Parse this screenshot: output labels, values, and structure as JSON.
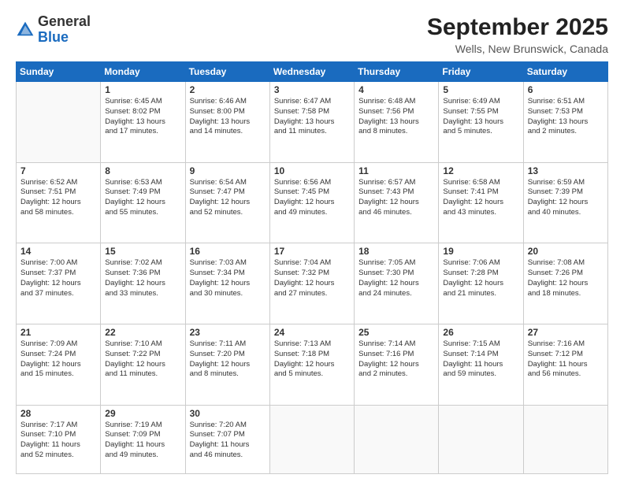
{
  "logo": {
    "general": "General",
    "blue": "Blue"
  },
  "header": {
    "month": "September 2025",
    "location": "Wells, New Brunswick, Canada"
  },
  "days": [
    "Sunday",
    "Monday",
    "Tuesday",
    "Wednesday",
    "Thursday",
    "Friday",
    "Saturday"
  ],
  "weeks": [
    [
      {
        "day": "",
        "info": ""
      },
      {
        "day": "1",
        "info": "Sunrise: 6:45 AM\nSunset: 8:02 PM\nDaylight: 13 hours\nand 17 minutes."
      },
      {
        "day": "2",
        "info": "Sunrise: 6:46 AM\nSunset: 8:00 PM\nDaylight: 13 hours\nand 14 minutes."
      },
      {
        "day": "3",
        "info": "Sunrise: 6:47 AM\nSunset: 7:58 PM\nDaylight: 13 hours\nand 11 minutes."
      },
      {
        "day": "4",
        "info": "Sunrise: 6:48 AM\nSunset: 7:56 PM\nDaylight: 13 hours\nand 8 minutes."
      },
      {
        "day": "5",
        "info": "Sunrise: 6:49 AM\nSunset: 7:55 PM\nDaylight: 13 hours\nand 5 minutes."
      },
      {
        "day": "6",
        "info": "Sunrise: 6:51 AM\nSunset: 7:53 PM\nDaylight: 13 hours\nand 2 minutes."
      }
    ],
    [
      {
        "day": "7",
        "info": "Sunrise: 6:52 AM\nSunset: 7:51 PM\nDaylight: 12 hours\nand 58 minutes."
      },
      {
        "day": "8",
        "info": "Sunrise: 6:53 AM\nSunset: 7:49 PM\nDaylight: 12 hours\nand 55 minutes."
      },
      {
        "day": "9",
        "info": "Sunrise: 6:54 AM\nSunset: 7:47 PM\nDaylight: 12 hours\nand 52 minutes."
      },
      {
        "day": "10",
        "info": "Sunrise: 6:56 AM\nSunset: 7:45 PM\nDaylight: 12 hours\nand 49 minutes."
      },
      {
        "day": "11",
        "info": "Sunrise: 6:57 AM\nSunset: 7:43 PM\nDaylight: 12 hours\nand 46 minutes."
      },
      {
        "day": "12",
        "info": "Sunrise: 6:58 AM\nSunset: 7:41 PM\nDaylight: 12 hours\nand 43 minutes."
      },
      {
        "day": "13",
        "info": "Sunrise: 6:59 AM\nSunset: 7:39 PM\nDaylight: 12 hours\nand 40 minutes."
      }
    ],
    [
      {
        "day": "14",
        "info": "Sunrise: 7:00 AM\nSunset: 7:37 PM\nDaylight: 12 hours\nand 37 minutes."
      },
      {
        "day": "15",
        "info": "Sunrise: 7:02 AM\nSunset: 7:36 PM\nDaylight: 12 hours\nand 33 minutes."
      },
      {
        "day": "16",
        "info": "Sunrise: 7:03 AM\nSunset: 7:34 PM\nDaylight: 12 hours\nand 30 minutes."
      },
      {
        "day": "17",
        "info": "Sunrise: 7:04 AM\nSunset: 7:32 PM\nDaylight: 12 hours\nand 27 minutes."
      },
      {
        "day": "18",
        "info": "Sunrise: 7:05 AM\nSunset: 7:30 PM\nDaylight: 12 hours\nand 24 minutes."
      },
      {
        "day": "19",
        "info": "Sunrise: 7:06 AM\nSunset: 7:28 PM\nDaylight: 12 hours\nand 21 minutes."
      },
      {
        "day": "20",
        "info": "Sunrise: 7:08 AM\nSunset: 7:26 PM\nDaylight: 12 hours\nand 18 minutes."
      }
    ],
    [
      {
        "day": "21",
        "info": "Sunrise: 7:09 AM\nSunset: 7:24 PM\nDaylight: 12 hours\nand 15 minutes."
      },
      {
        "day": "22",
        "info": "Sunrise: 7:10 AM\nSunset: 7:22 PM\nDaylight: 12 hours\nand 11 minutes."
      },
      {
        "day": "23",
        "info": "Sunrise: 7:11 AM\nSunset: 7:20 PM\nDaylight: 12 hours\nand 8 minutes."
      },
      {
        "day": "24",
        "info": "Sunrise: 7:13 AM\nSunset: 7:18 PM\nDaylight: 12 hours\nand 5 minutes."
      },
      {
        "day": "25",
        "info": "Sunrise: 7:14 AM\nSunset: 7:16 PM\nDaylight: 12 hours\nand 2 minutes."
      },
      {
        "day": "26",
        "info": "Sunrise: 7:15 AM\nSunset: 7:14 PM\nDaylight: 11 hours\nand 59 minutes."
      },
      {
        "day": "27",
        "info": "Sunrise: 7:16 AM\nSunset: 7:12 PM\nDaylight: 11 hours\nand 56 minutes."
      }
    ],
    [
      {
        "day": "28",
        "info": "Sunrise: 7:17 AM\nSunset: 7:10 PM\nDaylight: 11 hours\nand 52 minutes."
      },
      {
        "day": "29",
        "info": "Sunrise: 7:19 AM\nSunset: 7:09 PM\nDaylight: 11 hours\nand 49 minutes."
      },
      {
        "day": "30",
        "info": "Sunrise: 7:20 AM\nSunset: 7:07 PM\nDaylight: 11 hours\nand 46 minutes."
      },
      {
        "day": "",
        "info": ""
      },
      {
        "day": "",
        "info": ""
      },
      {
        "day": "",
        "info": ""
      },
      {
        "day": "",
        "info": ""
      }
    ]
  ]
}
